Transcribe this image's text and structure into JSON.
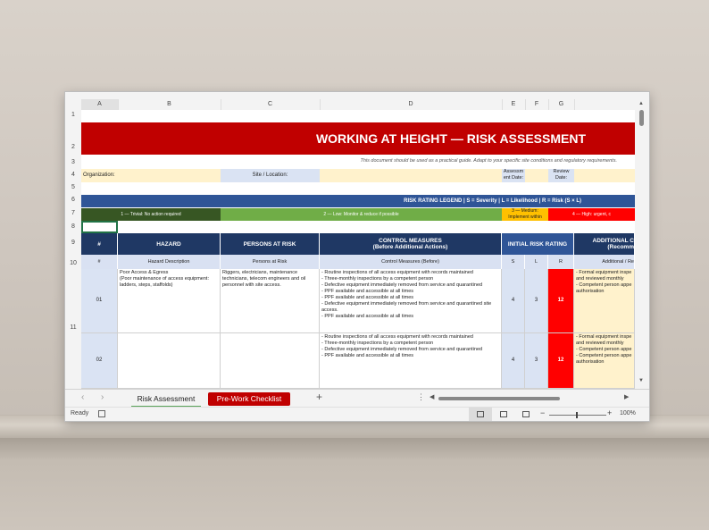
{
  "columns": [
    "A",
    "B",
    "C",
    "D",
    "E",
    "F",
    "G"
  ],
  "rows": [
    "1",
    "2",
    "3",
    "4",
    "5",
    "6",
    "7",
    "8",
    "9",
    "10",
    "11"
  ],
  "title": "WORKING AT HEIGHT — RISK ASSESSMENT",
  "disclaimer": "This document should be used as a practical guide. Adapt to your specific site conditions and regulatory requirements.",
  "info": {
    "organization": "Organization:",
    "site": "Site / Location:",
    "assessment_date": "Assessm ent Date:",
    "review_date": "Review Date:"
  },
  "legend": {
    "text": "RISK RATING LEGEND   |   S = Severity   |   L = Likelihood   |   R = Risk (S × L)",
    "levels": [
      {
        "label": "1 — Trivial: No action required",
        "color": "#375623"
      },
      {
        "label": "2 — Low: Monitor & reduce if possible",
        "color": "#70ad47"
      },
      {
        "label": "3 — Medium: Implement within",
        "color": "#ffc000"
      },
      {
        "label": "4 — High: urgent, c",
        "color": "#ff0000"
      }
    ]
  },
  "headers": {
    "num": "#",
    "hazard": "HAZARD",
    "persons": "PERSONS AT RISK",
    "controls": "CONTROL MEASURES",
    "controls_sub": "(Before Additional Actions)",
    "initial": "INITIAL RISK RATING",
    "additional": "ADDITIONAL C",
    "additional_sub": "(Recomm"
  },
  "subheaders": {
    "num": "#",
    "hazard": "Hazard Description",
    "persons": "Persons at Risk",
    "controls": "Control Measures (Before)",
    "s": "S",
    "l": "L",
    "r": "R",
    "additional": "Additional / Re"
  },
  "rows_data": [
    {
      "id": "01",
      "hazard": "Poor Access & Egress\n(Poor maintenance of access equipment: ladders, steps, staffolds)",
      "persons": "Riggers, electricians, maintenance technicians, telecom engineers and oil personnel with site access.",
      "controls": "- Routine inspections of all access equipment with records maintained\n- Three-monthly inspections by a competent person\n- Defective equipment immediately removed from service and quarantined\n- PPF available and accessible at all times\n- PPF available and accessible at all times\n- Defective equipment immediately removed from service and quarantined site access.\n- PPF available and accessible at all times",
      "s": "4",
      "l": "3",
      "r": "12",
      "additional": "- Formal equipment inspe\nand reviewed monthly\n- Competent person appe\nauthorisation"
    },
    {
      "id": "02",
      "hazard": "",
      "persons": "",
      "controls": "- Routine inspections of all access equipment with records maintained\n- Three-monthly inspections by a competent person\n- Defective equipment immediately removed from service and quarantined\n- PPF available and accessible at all times",
      "s": "4",
      "l": "3",
      "r": "12",
      "additional": "- Formal equipment inspe\nand reviewed monthly\n- Competent person appe\n- Competent person appe\nauthorisation"
    }
  ],
  "tabs": [
    "Risk Assessment",
    "Pre-Work Checklist"
  ],
  "status": {
    "ready": "Ready",
    "zoom": "100%"
  }
}
